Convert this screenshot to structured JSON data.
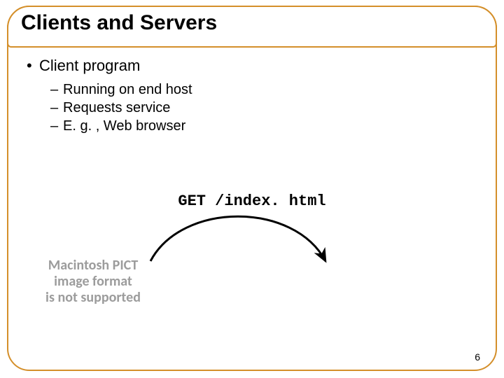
{
  "title": "Clients and Servers",
  "bullet1": "Client program",
  "sub1": "Running on end host",
  "sub2": "Requests service",
  "sub3": "E. g. , Web browser",
  "code": "GET /index. html",
  "pict_line1": "Macintosh PICT",
  "pict_line2": "image format",
  "pict_line3": "is not supported",
  "page_number": "6"
}
